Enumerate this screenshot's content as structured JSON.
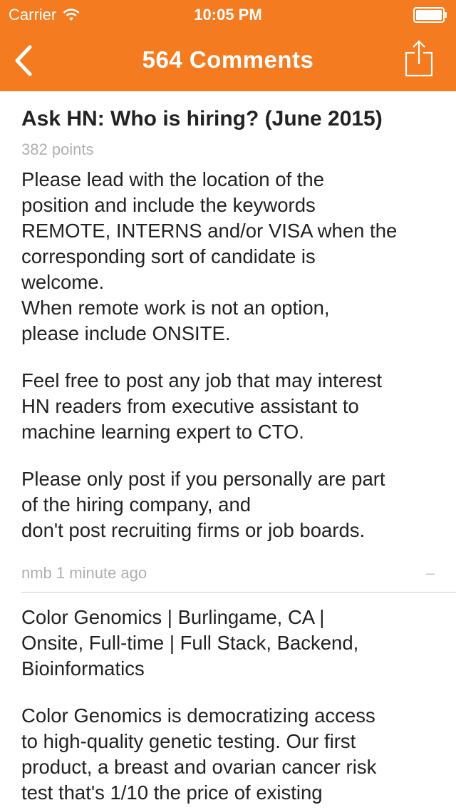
{
  "status_bar": {
    "carrier": "Carrier",
    "time": "10:05 PM"
  },
  "nav": {
    "title": "564 Comments",
    "back_icon": "chevron-left-icon",
    "share_icon": "share-icon"
  },
  "story": {
    "title": "Ask HN: Who is hiring? (June 2015)",
    "points": "382 points",
    "paragraphs": [
      [
        "Please lead with the location of the",
        "position and include the keywords",
        "REMOTE, INTERNS and/or VISA when the",
        "corresponding sort of candidate is",
        "welcome.",
        "When remote work is not an option,",
        "please include ONSITE."
      ],
      [
        "Feel free to post any job that may interest",
        "HN readers from executive assistant to",
        "machine learning expert to CTO."
      ],
      [
        "Please only post if you personally are part",
        "of the hiring company, and",
        "don't post recruiting firms or job boards."
      ]
    ]
  },
  "comment": {
    "author_time": "nmb 1 minute ago",
    "collapse_label": "–",
    "paragraphs": [
      [
        "Color Genomics | Burlingame, CA |",
        "Onsite, Full-time | Full Stack, Backend,",
        "Bioinformatics"
      ],
      [
        "Color Genomics is democratizing access",
        "to high-quality genetic testing. Our first",
        "product, a breast and ovarian cancer risk",
        "test that's 1/10 the price of existing"
      ]
    ]
  },
  "colors": {
    "accent": "#f47b20",
    "meta_text": "#b0b0b0"
  }
}
